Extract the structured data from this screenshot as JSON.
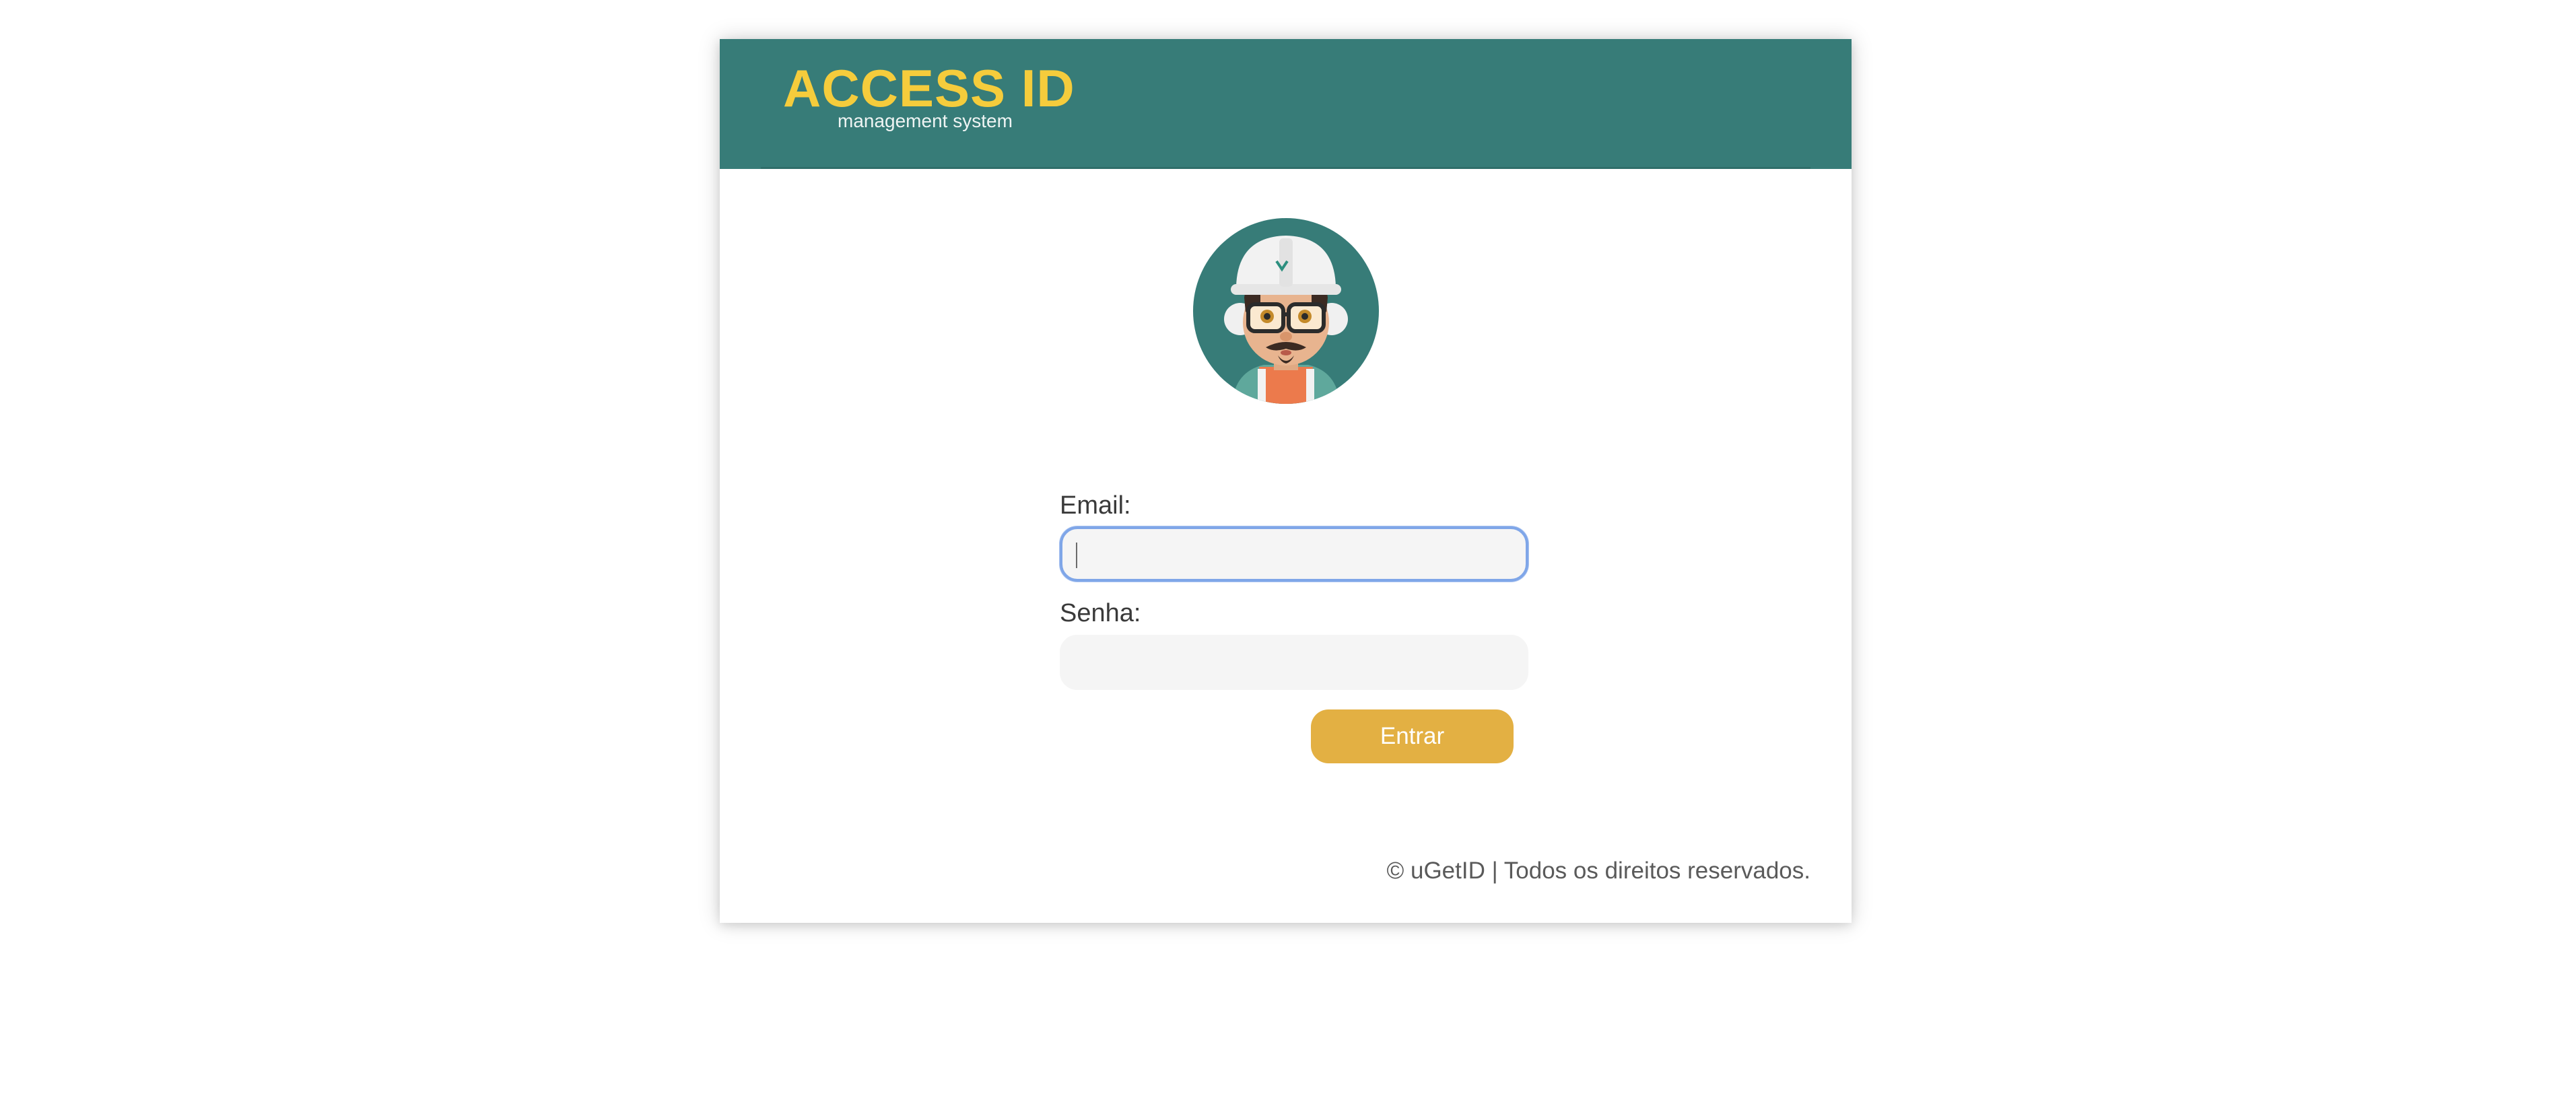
{
  "header": {
    "logo_title": "ACCESS ID",
    "logo_subtitle": "management system",
    "background_color": "#377c78",
    "title_color": "#f5cc3c"
  },
  "avatar": {
    "icon": "worker-avatar-icon",
    "helmet_brand": "VALE"
  },
  "form": {
    "email_label": "Email:",
    "email_value": "",
    "email_placeholder": "",
    "password_label": "Senha:",
    "password_value": "",
    "password_placeholder": "",
    "submit_label": "Entrar",
    "submit_color": "#e3b043"
  },
  "footer": {
    "text": "© uGetID | Todos os direitos reservados."
  }
}
